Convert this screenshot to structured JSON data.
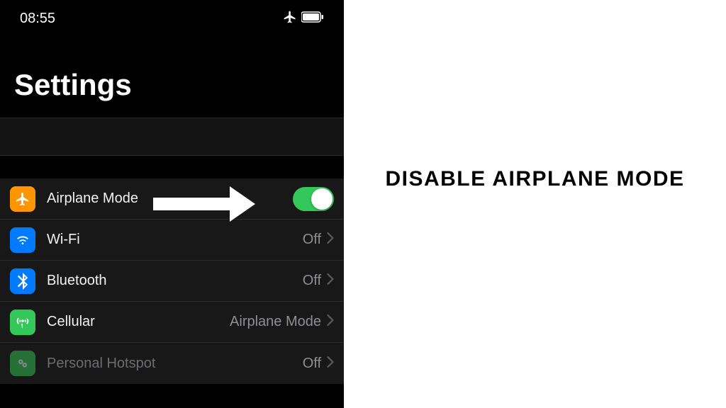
{
  "status": {
    "time": "08:55"
  },
  "title": "Settings",
  "rows": {
    "airplane": {
      "label": "Airplane Mode"
    },
    "wifi": {
      "label": "Wi-Fi",
      "value": "Off"
    },
    "bluetooth": {
      "label": "Bluetooth",
      "value": "Off"
    },
    "cellular": {
      "label": "Cellular",
      "value": "Airplane Mode"
    },
    "hotspot": {
      "label": "Personal Hotspot",
      "value": "Off"
    }
  },
  "instruction": "DISABLE AIRPLANE MODE",
  "colors": {
    "airplane_icon": "#ff9500",
    "wifi_icon": "#007aff",
    "bluetooth_icon": "#007aff",
    "cellular_icon": "#34c759",
    "hotspot_icon": "#34c759",
    "toggle_on": "#34c759"
  }
}
